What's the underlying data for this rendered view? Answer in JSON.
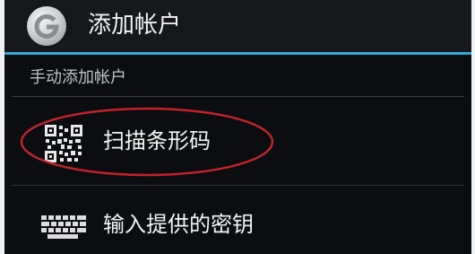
{
  "header": {
    "title": "添加帐户",
    "logo_icon": "google-g-icon"
  },
  "section": {
    "title": "手动添加帐户"
  },
  "options": [
    {
      "label": "扫描条形码",
      "icon": "qr-code-icon"
    },
    {
      "label": "输入提供的密钥",
      "icon": "keyboard-icon"
    }
  ],
  "colors": {
    "background": "#0b0d10",
    "header_underline": "#2fa7d8",
    "annotation_oval": "#c0242b"
  }
}
